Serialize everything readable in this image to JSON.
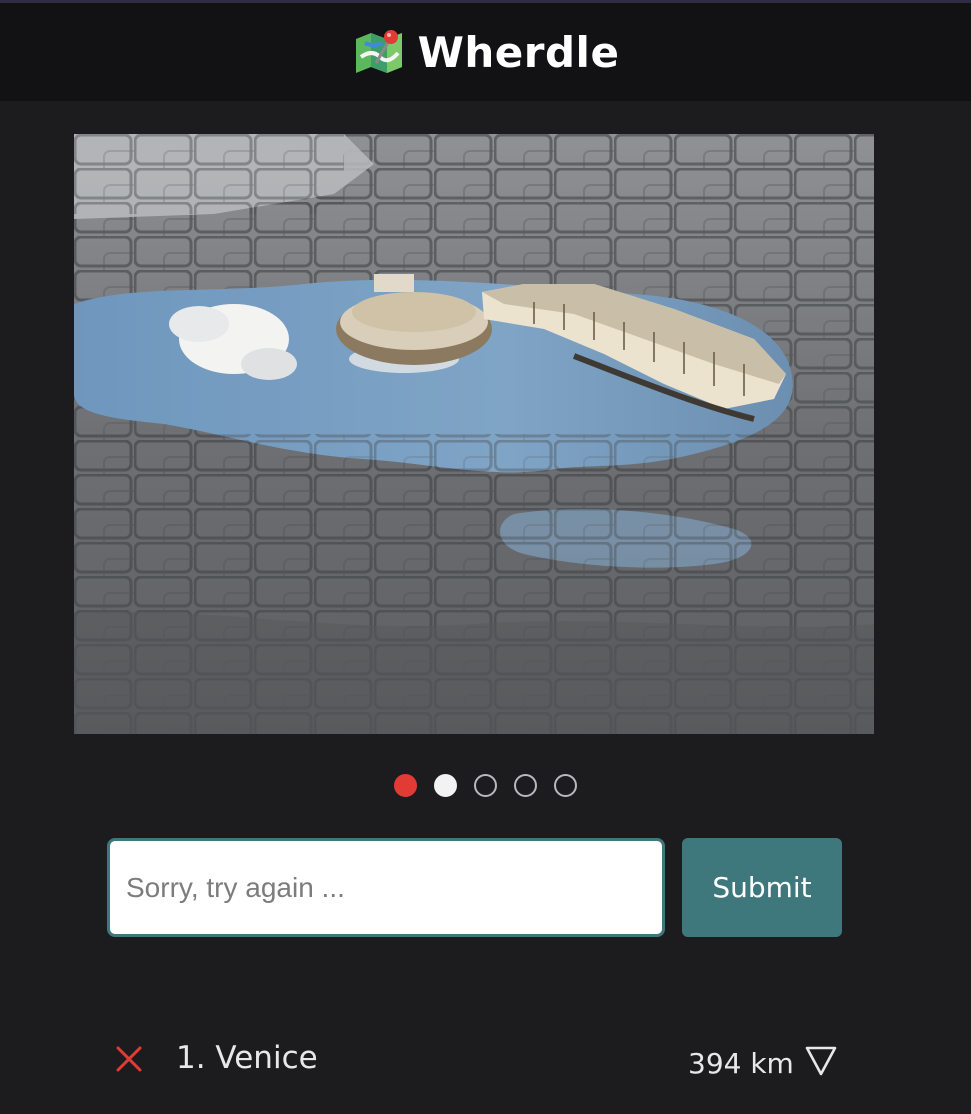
{
  "app": {
    "title": "Wherdle",
    "logo_icon": "folded-map-pin-icon"
  },
  "photo": {
    "subject": "puddle-reflection-photo"
  },
  "progress": {
    "total": 5,
    "current": 1,
    "states": [
      "active",
      "viewed",
      "empty",
      "empty",
      "empty"
    ],
    "active_color": "#e23b36"
  },
  "guess_form": {
    "placeholder": "Sorry, try again ...",
    "value": "",
    "submit_label": "Submit",
    "accent_color": "#3f787c"
  },
  "guesses": [
    {
      "label": "1. Venice",
      "distance": "394 km",
      "result_icon": "x-icon",
      "direction_icon": "arrow-direction-icon"
    }
  ]
}
